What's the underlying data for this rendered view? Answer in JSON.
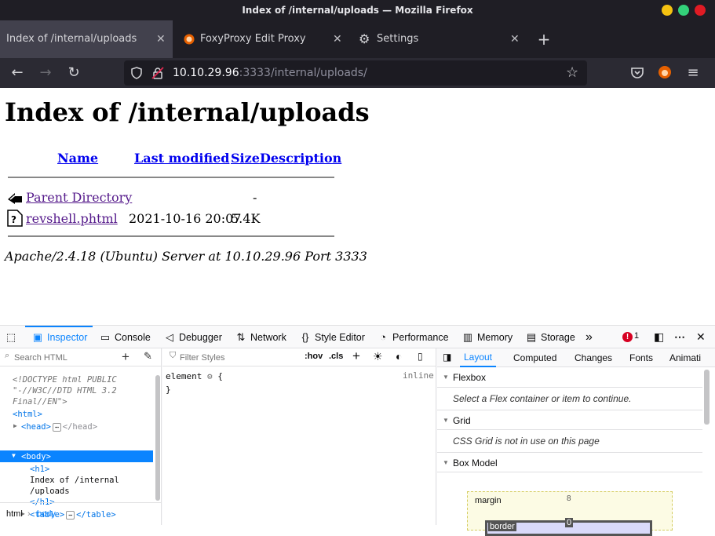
{
  "window": {
    "title": "Index of /internal/uploads — Mozilla Firefox"
  },
  "tabs": [
    {
      "label": "Index of /internal/uploads",
      "active": true
    },
    {
      "label": "FoxyProxy Edit Proxy",
      "active": false
    },
    {
      "label": "Settings",
      "active": false
    }
  ],
  "new_tab_label": "+",
  "urlbar": {
    "host": "10.10.29.96",
    "rest": ":3333/internal/uploads/"
  },
  "page": {
    "heading": "Index of /internal/uploads",
    "columns": [
      "Name",
      "Last modified",
      "Size",
      "Description"
    ],
    "rows": [
      {
        "icon": "back-icon",
        "name": "Parent Directory",
        "modified": "",
        "size": "-",
        "description": ""
      },
      {
        "icon": "unknown-file-icon",
        "name": "revshell.phtml",
        "modified": "2021-10-16 20:07",
        "size": "5.4K",
        "description": ""
      }
    ],
    "address": "Apache/2.4.18 (Ubuntu) Server at 10.10.29.96 Port 3333"
  },
  "devtools": {
    "tabs": [
      "Inspector",
      "Console",
      "Debugger",
      "Network",
      "Style Editor",
      "Performance",
      "Memory",
      "Storage"
    ],
    "active_tab": "Inspector",
    "error_count": "1",
    "search_placeholder": "Search HTML",
    "markup": {
      "doctype_1": "<!DOCTYPE html PUBLIC",
      "doctype_2": "\"-//W3C//DTD HTML 3.2",
      "doctype_3": "Final//EN\">",
      "html_open": "<html>",
      "head": "<head>",
      "head_close": "</head>",
      "body": "<body>",
      "h1_open": "<h1>",
      "h1_text_1": "Index of /internal",
      "h1_text_2": "/uploads",
      "h1_close": "</h1>",
      "table_open": "<table>",
      "table_close": "</table>"
    },
    "breadcrumbs": [
      "html",
      "body"
    ],
    "rules": {
      "filter_placeholder": "Filter Styles",
      "hov": ":hov",
      "cls": ".cls",
      "selector": "element",
      "open_brace": "{",
      "close_brace": "}",
      "display": "inline"
    },
    "layout": {
      "tabs": [
        "Layout",
        "Computed",
        "Changes",
        "Fonts",
        "Animati"
      ],
      "active_tab": "Layout",
      "sections": [
        {
          "title": "Flexbox",
          "body": "Select a Flex container or item to continue."
        },
        {
          "title": "Grid",
          "body": "CSS Grid is not in use on this page"
        },
        {
          "title": "Box Model",
          "body": ""
        }
      ],
      "box_model": {
        "margin_label": "margin",
        "margin_top": "8",
        "border_label": "border",
        "border_top": "0"
      }
    }
  },
  "colors": {
    "accent": "#0a84ff",
    "link": "#0000ee",
    "visited": "#551a8b",
    "chrome_dark": "#1f1e25"
  }
}
